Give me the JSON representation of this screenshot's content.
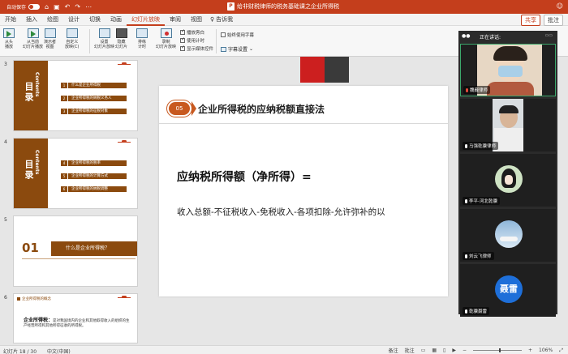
{
  "titlebar": {
    "autosave_label": "自动保存",
    "autosave_state": "关闭",
    "doc_title": "给非财税律师的税务基础课之企业所得税",
    "doc_badge": "P"
  },
  "tabs": [
    "开始",
    "插入",
    "绘图",
    "设计",
    "切换",
    "动画",
    "幻灯片放映",
    "审阅",
    "视图"
  ],
  "active_tab": "幻灯片放映",
  "tell_me": "告诉我",
  "share": "共享",
  "comments": "批注",
  "ribbon": {
    "from_start": "从头\n播放",
    "from_current": "从当前\n幻灯片播放",
    "presenter": "演示者\n视图",
    "custom_show": "自定义\n放映(C)",
    "setup_show": "设置\n幻灯片放映",
    "hide_slide": "隐藏\n幻灯片",
    "rehearse": "排练\n计时",
    "record": "录制\n幻灯片放映",
    "chk_narrations": "播放旁白",
    "chk_timings": "使用计时",
    "chk_media_controls": "显示媒体控件",
    "chk_subtitles": "始终使用字幕",
    "subtitle_settings": "字幕设置"
  },
  "thumbnails": [
    {
      "num": "3",
      "mulu": "目录",
      "contents": "Contents",
      "items": [
        {
          "idx": "1",
          "label": "什么是企业所得税"
        },
        {
          "idx": "2",
          "label": "企业所得税的纳税义务人"
        },
        {
          "idx": "3",
          "label": "企业所得税的征税对象"
        }
      ]
    },
    {
      "num": "4",
      "mulu": "目录",
      "contents": "Contents",
      "items": [
        {
          "idx": "4",
          "label": "企业所得税的税率"
        },
        {
          "idx": "5",
          "label": "企业所得税的计算方式"
        },
        {
          "idx": "6",
          "label": "企业所得税的纳税调整"
        }
      ]
    },
    {
      "num": "5",
      "big": "01",
      "bar": "什么是企业所得税？"
    },
    {
      "num": "6",
      "head": "企业所得税的概念",
      "body_bold": "企业所得税：",
      "body": "是对我国境内的企业和其他取得收入的组织的生产经营所得和其他所得征收的所得税。"
    }
  ],
  "slide": {
    "badge": "05",
    "title": "企业所得税的应纳税额直接法",
    "formula": "应纳税所得额（净所得）=",
    "formula2": "收入总额-不征税收入-免税收入-各项扣除-允许弥补的以"
  },
  "people": {
    "header": "正在讲话:",
    "participants": [
      {
        "name": "魏巍律师",
        "mic": "red"
      },
      {
        "name": "马强乾骥律师",
        "mic": "white"
      },
      {
        "name": "李平-河北乾骥",
        "mic": "white"
      },
      {
        "name": "刘云飞律师",
        "mic": "white"
      },
      {
        "name": "乾骥聂雷",
        "mic": "white",
        "avatar_letter": "聂雷"
      }
    ]
  },
  "status": {
    "slide_pos": "幻灯片 18 / 30",
    "language": "中文(中国)",
    "notes": "备注",
    "comments": "批注",
    "zoom": "106%"
  },
  "colors": {
    "accent": "#c43e1c",
    "brown": "#8b4a0e",
    "badge": "#c8591f"
  }
}
